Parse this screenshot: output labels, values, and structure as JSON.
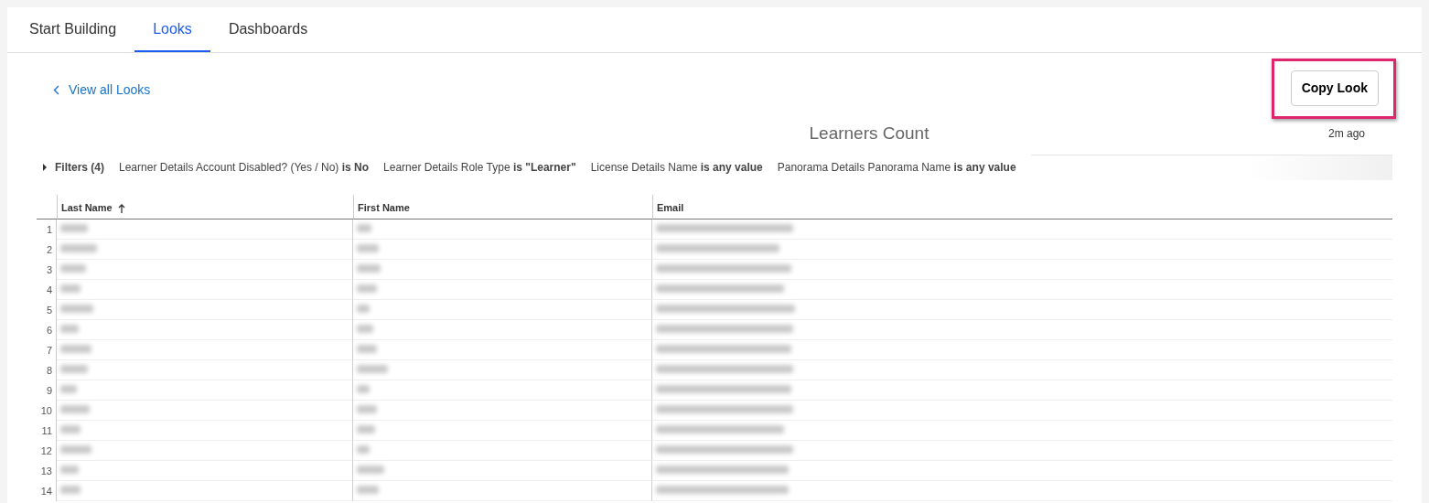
{
  "tabs": [
    {
      "label": "Start Building",
      "selected": false
    },
    {
      "label": "Looks",
      "selected": true
    },
    {
      "label": "Dashboards",
      "selected": false
    }
  ],
  "back_link": {
    "label": "View all Looks"
  },
  "copy_button": {
    "label": "Copy Look",
    "highlighted": true
  },
  "title": "Learners Count",
  "updated": "2m ago",
  "filters": {
    "label": "Filters (4)",
    "expanded": false,
    "items": [
      "Learner Details Account Disabled? (Yes / No) **is No**",
      "Learner Details Role Type **is \"Learner\"**",
      "License Details Name **is any value**",
      "Panorama Details Panorama Name **is any value**"
    ]
  },
  "table": {
    "columns": [
      {
        "label": "Last Name",
        "sorted": true
      },
      {
        "label": "First Name",
        "sorted": false
      },
      {
        "label": "Email",
        "sorted": false
      }
    ],
    "rows": [
      {
        "number": "1"
      },
      {
        "number": "2"
      },
      {
        "number": "3"
      },
      {
        "number": "4"
      },
      {
        "number": "5"
      },
      {
        "number": "6"
      },
      {
        "number": "7"
      },
      {
        "number": "8"
      },
      {
        "number": "9"
      },
      {
        "number": "10"
      },
      {
        "number": "11"
      },
      {
        "number": "12"
      },
      {
        "number": "13"
      },
      {
        "number": "14"
      }
    ]
  }
}
